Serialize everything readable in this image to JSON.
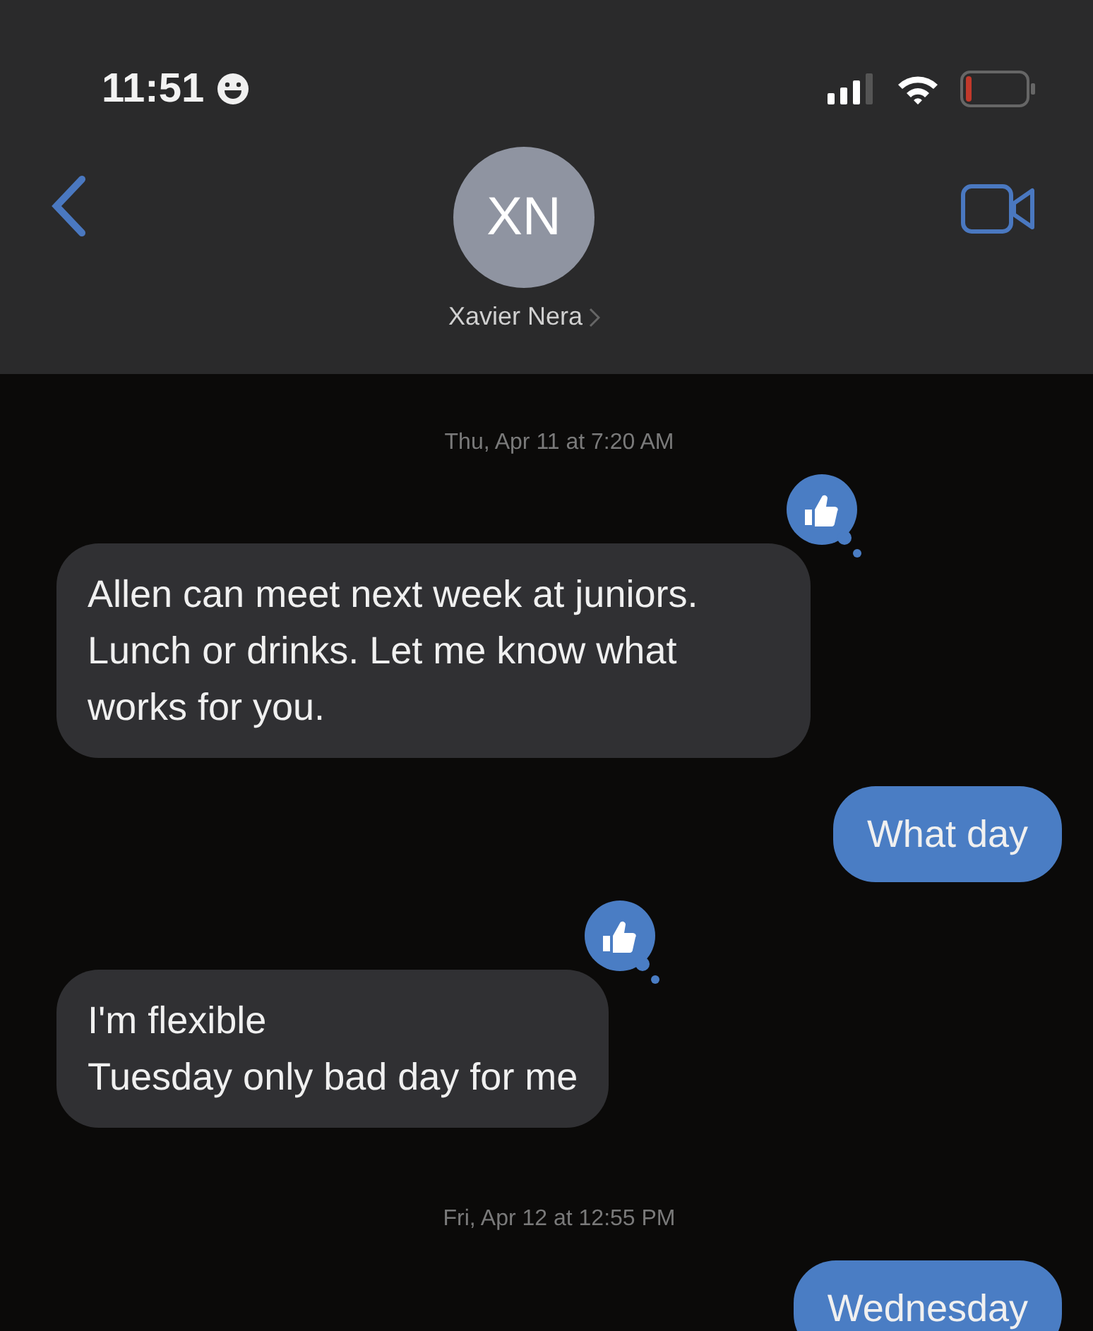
{
  "status_bar": {
    "time": "11:51"
  },
  "contact": {
    "initials": "XN",
    "name": "Xavier Nera"
  },
  "messages": [
    {
      "kind": "timestamp",
      "text": "Thu, Apr 11 at 7:20 AM"
    },
    {
      "kind": "received",
      "text": "Allen can meet next week at juniors. Lunch or drinks. Let me know what works for you.",
      "reaction": true
    },
    {
      "kind": "sent",
      "text": "What day"
    },
    {
      "kind": "received",
      "text": "I'm flexible\nTuesday only bad day for me",
      "reaction": true
    },
    {
      "kind": "timestamp",
      "text": "Fri, Apr 12 at 12:55 PM"
    },
    {
      "kind": "sent",
      "text": "Wednesday"
    }
  ]
}
